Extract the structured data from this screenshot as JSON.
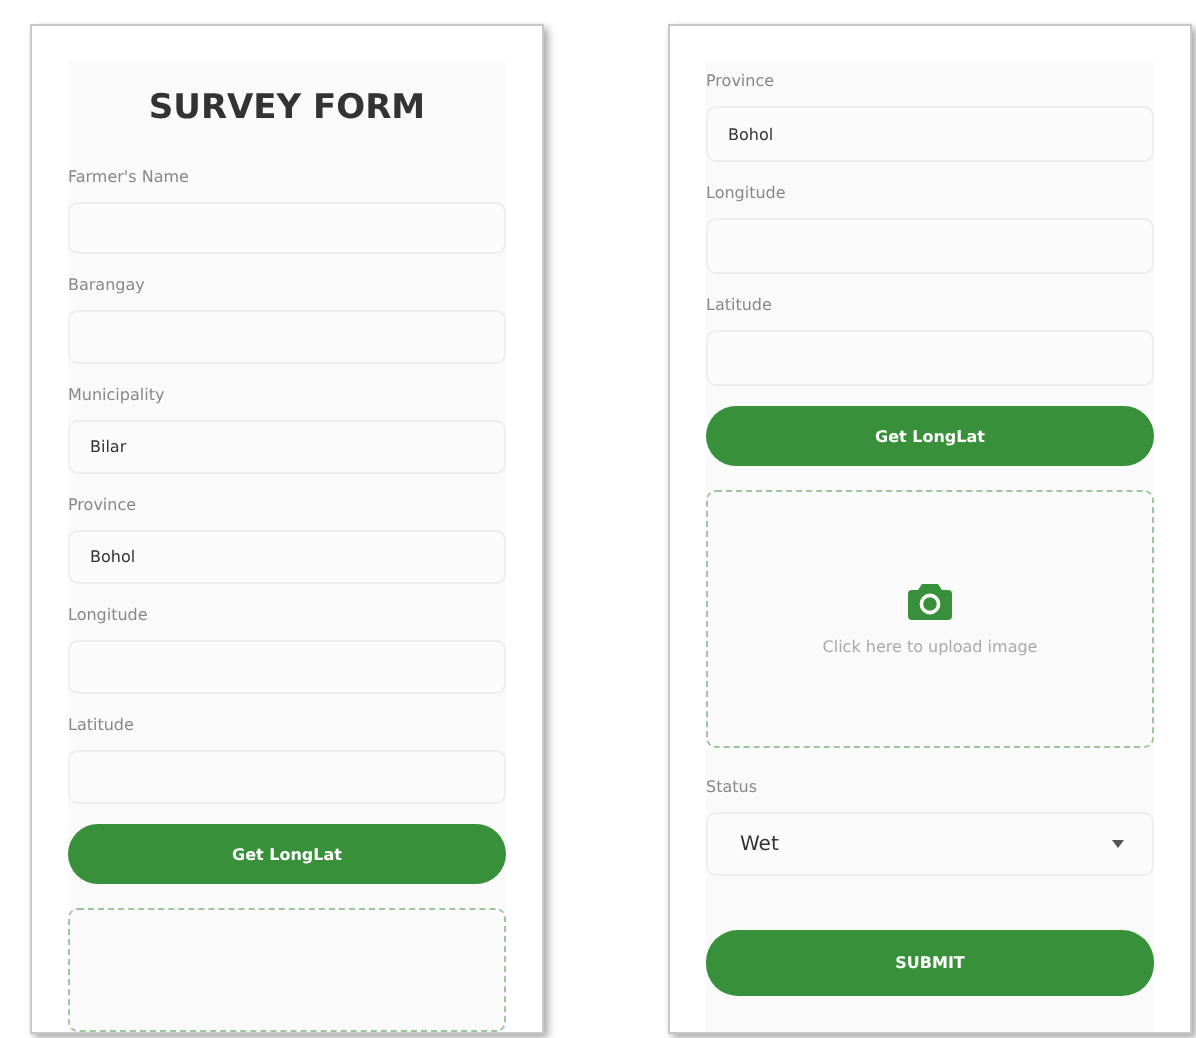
{
  "screens": [
    {
      "title": "SURVEY FORM",
      "items": [
        {
          "kind": "field",
          "label": "Farmer's Name",
          "value": ""
        },
        {
          "kind": "field",
          "label": "Barangay",
          "value": ""
        },
        {
          "kind": "field",
          "label": "Municipality",
          "value": "Bilar"
        },
        {
          "kind": "field",
          "label": "Province",
          "value": "Bohol"
        },
        {
          "kind": "field",
          "label": "Longitude",
          "value": ""
        },
        {
          "kind": "field",
          "label": "Latitude",
          "value": ""
        },
        {
          "kind": "button",
          "label": "Get LongLat"
        },
        {
          "kind": "upload"
        }
      ]
    },
    {
      "items": [
        {
          "kind": "field",
          "label": "Province",
          "value": "Bohol"
        },
        {
          "kind": "field",
          "label": "Longitude",
          "value": ""
        },
        {
          "kind": "field",
          "label": "Latitude",
          "value": ""
        },
        {
          "kind": "button",
          "label": "Get LongLat"
        },
        {
          "kind": "upload",
          "text": "Click here to upload image"
        },
        {
          "kind": "select",
          "label": "Status",
          "value": "Wet"
        },
        {
          "kind": "submit",
          "label": "SUBMIT"
        }
      ]
    }
  ]
}
